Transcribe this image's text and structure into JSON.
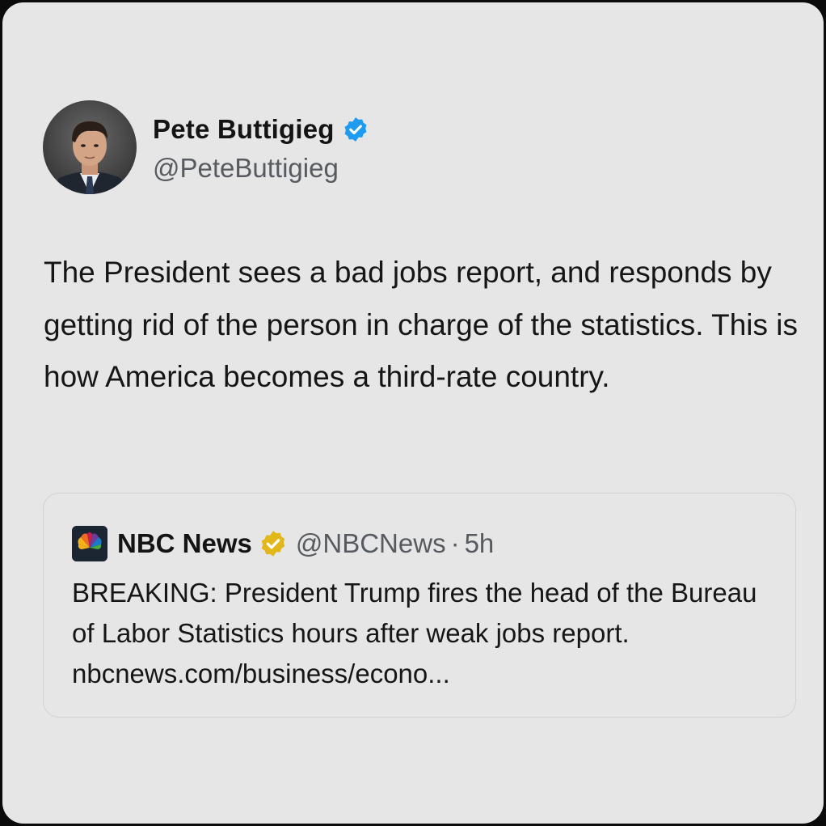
{
  "tweet": {
    "author": {
      "name": "Pete Buttigieg",
      "handle": "@PeteButtigieg",
      "verified": true,
      "verified_color": "#1d9bf0",
      "avatar_icon": "profile-photo"
    },
    "text": "The President sees a bad jobs report, and responds by getting rid of the person in charge of the statistics. This is how America becomes a third-rate country."
  },
  "quote": {
    "author": {
      "name": "NBC News",
      "handle": "@NBCNews",
      "verified": true,
      "verified_color": "#e2b719",
      "logo_icon": "nbc-peacock-logo"
    },
    "separator": "·",
    "time": "5h",
    "text": "BREAKING: President Trump fires the head of the Bureau of Labor Statistics hours after weak jobs report. nbcnews.com/business/econo..."
  },
  "colors": {
    "card_background": "#e6e6e6",
    "secondary_text": "#575b5f"
  }
}
